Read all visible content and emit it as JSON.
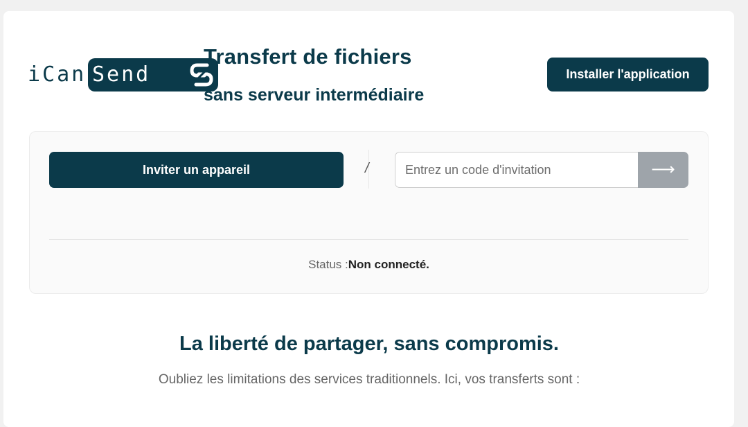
{
  "header": {
    "logo_prefix": "iCan",
    "logo_highlight": "Send",
    "title": "Transfert de fichiers",
    "subtitle": "sans serveur intermédiaire",
    "install_label": "Installer l'application"
  },
  "connect": {
    "invite_label": "Inviter un appareil",
    "separator": "/",
    "code_placeholder": "Entrez un code d'invitation",
    "code_value": "",
    "submit_icon": "arrow-right-icon",
    "submit_glyph": "⟶",
    "status_label": "Status :",
    "status_value": "Non connecté."
  },
  "hero": {
    "title": "La liberté de partager, sans compromis.",
    "text": "Oubliez les limitations des services traditionnels. Ici, vos transferts sont :"
  },
  "colors": {
    "brand": "#0b3a4a",
    "submit_disabled": "#9ea4aa",
    "page_bg": "#f1f1f1"
  }
}
